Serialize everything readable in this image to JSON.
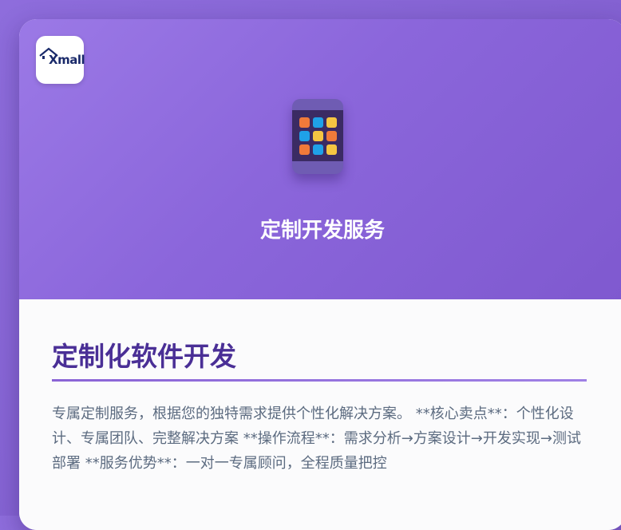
{
  "logo": {
    "text": "Xmall",
    "icon": "roof-icon"
  },
  "hero": {
    "title": "定制开发服务",
    "icon": "app-grid-icon",
    "dot_colors": [
      "#f07a3a",
      "#1fa1e8",
      "#f5c542",
      "#1fa1e8",
      "#f5c542",
      "#f07a3a",
      "#f07a3a",
      "#1fa1e8",
      "#f5c542"
    ]
  },
  "section": {
    "title": "定制化软件开发",
    "description": "专属定制服务，根据您的独特需求提供个性化解决方案。 **核心卖点**：个性化设计、专属团队、完整解决方案 **操作流程**：需求分析→方案设计→开发实现→测试部署 **服务优势**：一对一专属顾问，全程质量把控"
  },
  "colors": {
    "hero_start": "#9b79e6",
    "hero_end": "#7f59cf",
    "title_purple": "#4a2f96",
    "text_gray": "#5c6b80"
  }
}
